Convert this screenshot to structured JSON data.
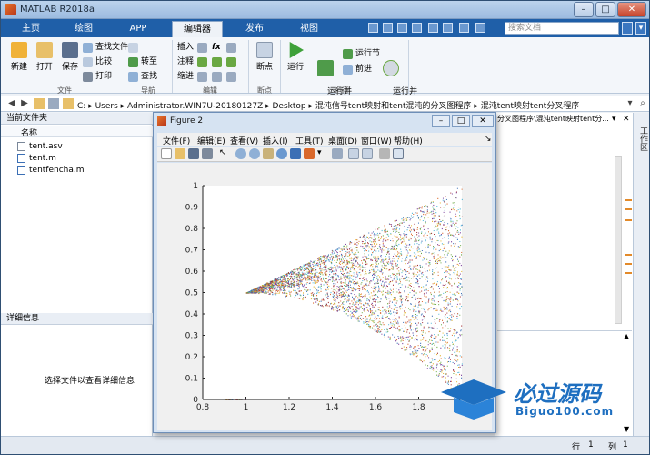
{
  "app": {
    "title": "MATLAB R2018a"
  },
  "tabs": [
    "主页",
    "绘图",
    "APP",
    "编辑器",
    "发布",
    "视图"
  ],
  "active_tab": "编辑器",
  "search": {
    "placeholder": "搜索文档"
  },
  "ribbon": {
    "file": {
      "new": "新建",
      "open": "打开",
      "save": "保存",
      "find_files": "查找文件",
      "compare": "比较",
      "print": "打印",
      "group": "文件"
    },
    "nav": {
      "go_to": "转至",
      "find": "查找",
      "group": "导航"
    },
    "edit": {
      "insert": "插入",
      "comment": "注释",
      "indent": "缩进",
      "fx": "fx",
      "group": "编辑"
    },
    "breakpoint": {
      "label": "断点",
      "group": "断点"
    },
    "run": {
      "run": "运行",
      "run_advance": "运行并\n前进",
      "run_section": "运行节",
      "advance": "前进",
      "run_time": "运行并\n计时",
      "group": "运行"
    }
  },
  "address": {
    "crumbs": [
      "C:",
      "Users",
      "Administrator.WIN7U-20180127Z",
      "Desktop",
      "混沌信号tent映射和tent混沌的分叉图程序",
      "混沌tent映射tent分叉程序"
    ]
  },
  "current_folder": {
    "header": "当前文件夹",
    "col_name": "名称",
    "files": [
      "tent.asv",
      "tent.m",
      "tentfencha.m"
    ]
  },
  "details": {
    "header": "详细信息",
    "message": "选择文件以查看详细信息"
  },
  "right_panel": {
    "path_snippet": "分叉图程序\\混沌tent映射tent分...",
    "workspace_label": "工作区"
  },
  "status": {
    "row_label": "行",
    "row": "1",
    "col_label": "列",
    "col": "1"
  },
  "figure": {
    "title": "Figure 2",
    "menu": [
      "文件(F)",
      "编辑(E)",
      "查看(V)",
      "插入(I)",
      "工具(T)",
      "桌面(D)",
      "窗口(W)",
      "帮助(H)"
    ],
    "chart_data": {
      "type": "scatter",
      "title": "",
      "xlabel": "",
      "ylabel": "",
      "xlim": [
        0.8,
        2
      ],
      "ylim": [
        0,
        1
      ],
      "x_ticks": [
        "0.8",
        "1",
        "1.2",
        "1.4",
        "1.6",
        "1.8"
      ],
      "y_ticks": [
        "0",
        "0.1",
        "0.2",
        "0.3",
        "0.4",
        "0.5",
        "0.6",
        "0.7",
        "0.8",
        "0.9",
        "1"
      ],
      "description_values": {
        "bifurcation_start_x": 1.0,
        "branch_point_y": 0.5,
        "upper_bound_at_x2": 1.0,
        "lower_bound_at_x2": 0.0
      },
      "colors": [
        "#3b6fb5",
        "#d9682b",
        "#e3b32a",
        "#7b3f9c",
        "#6aa843",
        "#4db6d8",
        "#a33035"
      ]
    }
  },
  "watermark": {
    "text_cn": "必过源码",
    "text_en": "Biguo100.com"
  }
}
